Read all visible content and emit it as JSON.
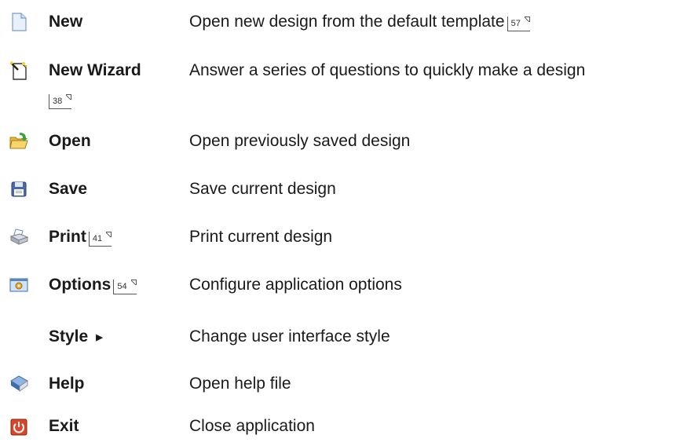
{
  "menu": [
    {
      "icon": "new-document-icon",
      "command": "New",
      "description": "Open new design from the default template",
      "page_ref": "57"
    },
    {
      "icon": "new-wizard-icon",
      "command": "New Wizard",
      "description": "Answer a series of questions to quickly make a design",
      "page_ref": "38"
    },
    {
      "icon": "open-folder-icon",
      "command": "Open",
      "description": "Open previously saved design"
    },
    {
      "icon": "save-floppy-icon",
      "command": "Save",
      "description": "Save current design"
    },
    {
      "icon": "printer-icon",
      "command": "Print",
      "description": "Print current design",
      "page_ref": "41"
    },
    {
      "icon": "options-icon",
      "command": "Options",
      "description": "Configure application options",
      "page_ref": "54"
    },
    {
      "command": "Style",
      "submenu_icon": "submenu-arrow-icon",
      "submenu_glyph": "▶",
      "description": "Change user interface style"
    },
    {
      "icon": "help-book-icon",
      "command": "Help",
      "description": "Open help file"
    },
    {
      "icon": "exit-power-icon",
      "command": "Exit",
      "description": "Close application"
    }
  ]
}
